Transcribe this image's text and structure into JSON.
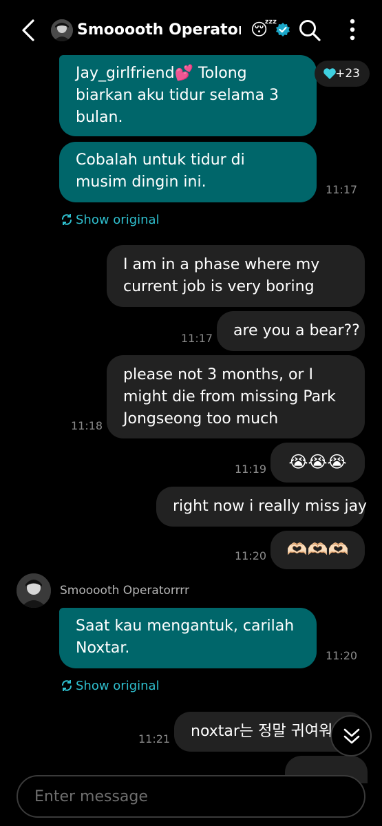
{
  "header": {
    "title": "Smooooth Operator...",
    "title_emoji": "😴",
    "verified_color": "#1aa7c9"
  },
  "messages": [
    {
      "text": "Jay_girlfriend💕 Tolong biarkan aku tidur selama 3 bulan."
    },
    {
      "text": "Cobalah untuk tidur di musim dingin ini.",
      "time": "11:17"
    },
    {
      "text": "I am in a phase where my current job is very boring"
    },
    {
      "text": "are you a bear??",
      "time": "11:17"
    },
    {
      "text": "please not 3 months, or I might die from missing Park Jongseong too much",
      "time": "11:18"
    },
    {
      "text": "😭😭😭",
      "time": "11:19"
    },
    {
      "text": "right now i really miss jay"
    },
    {
      "text": "🫶🏻🫶🏻🫶🏻",
      "time": "11:20"
    },
    {
      "text": "Saat kau mengantuk, carilah Noxtar.",
      "time": "11:20"
    },
    {
      "text": "noxtar는 정말 귀여워",
      "time": "11:21"
    }
  ],
  "show_original": "Show original",
  "reaction": {
    "icon": "heart-icon",
    "count": "+23",
    "color": "#3fd0e0"
  },
  "sender_name": "Smooooth Operatorrrr",
  "composer": {
    "placeholder": "Enter message"
  },
  "colors": {
    "incoming": "#00666a",
    "outgoing": "#222222",
    "link": "#2fc0cf"
  }
}
